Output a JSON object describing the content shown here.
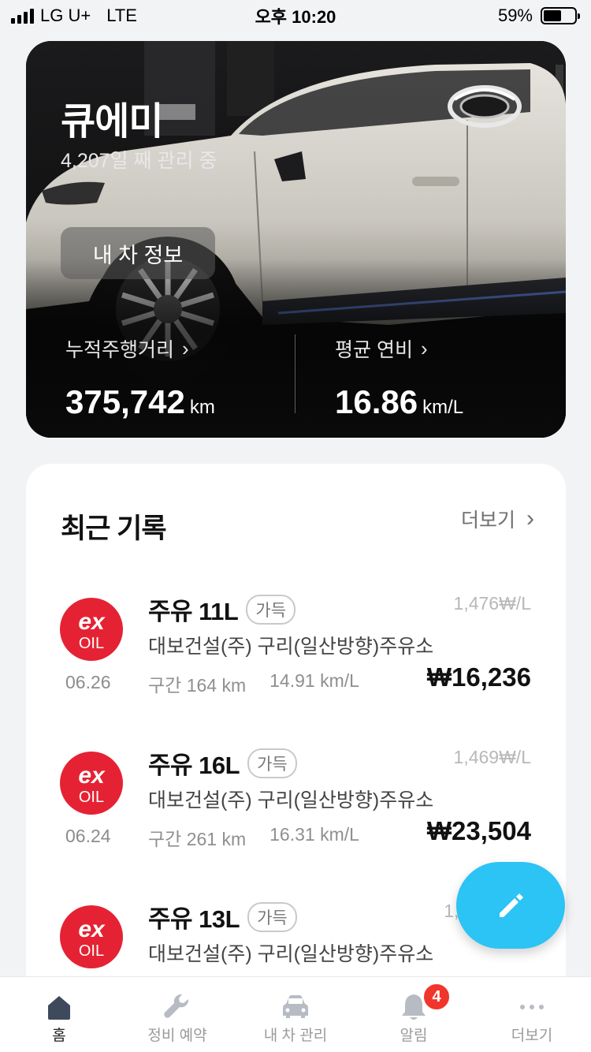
{
  "status_bar": {
    "carrier": "LG U+",
    "network": "LTE",
    "time": "오후 10:20",
    "battery": "59%",
    "battery_level": 0.59
  },
  "hero": {
    "car_name": "큐에미",
    "days_managed": "4,207일 째 관리 중",
    "info_button": "내 차 정보",
    "mileage": {
      "label": "누적주행거리",
      "value": "375,742",
      "unit": "km"
    },
    "efficiency": {
      "label": "평균 연비",
      "value": "16.86",
      "unit": "km/L"
    }
  },
  "records": {
    "title": "최근 기록",
    "more": "더보기",
    "items": [
      {
        "logo_top": "ex",
        "logo_bottom": "OIL",
        "title": "주유 11L",
        "badge": "가득",
        "unit_price": "1,476₩/L",
        "station": "대보건설(주) 구리(일산방향)주유소",
        "date": "06.26",
        "distance": "구간 164 km",
        "efficiency": "14.91 km/L",
        "total": "₩16,236"
      },
      {
        "logo_top": "ex",
        "logo_bottom": "OIL",
        "title": "주유 16L",
        "badge": "가득",
        "unit_price": "1,469₩/L",
        "station": "대보건설(주) 구리(일산방향)주유소",
        "date": "06.24",
        "distance": "구간 261 km",
        "efficiency": "16.31 km/L",
        "total": "₩23,504"
      },
      {
        "logo_top": "ex",
        "logo_bottom": "OIL",
        "title": "주유 13L",
        "badge": "가득",
        "unit_price": "1,42",
        "station": "대보건설(주) 구리(일산방향)주유소"
      }
    ]
  },
  "tabs": [
    {
      "label": "홈",
      "icon": "home-icon",
      "active": true
    },
    {
      "label": "정비 예약",
      "icon": "wrench-icon"
    },
    {
      "label": "내 차 관리",
      "icon": "car-icon"
    },
    {
      "label": "알림",
      "icon": "bell-icon",
      "badge": "4"
    },
    {
      "label": "더보기",
      "icon": "more-dots-icon"
    }
  ],
  "colors": {
    "accent_fab": "#2cc3f5",
    "exoil_red": "#e52233",
    "badge_red": "#f1352c"
  }
}
